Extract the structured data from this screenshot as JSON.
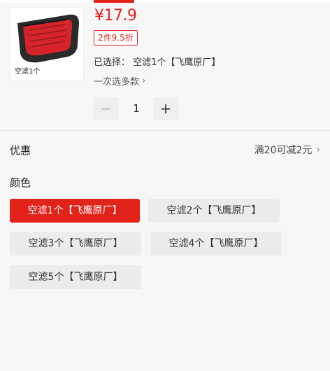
{
  "product": {
    "price": "¥17.9",
    "promo_tag": "2件9.5折",
    "selected_text": "已选择：  空滤1个【飞鹰原厂】",
    "multi_select_label": "一次选多款",
    "thumbnail_caption": "空滤1个",
    "quantity": "1",
    "accent_color": "#e2231a"
  },
  "stepper": {
    "minus": "−",
    "plus": "+"
  },
  "discount": {
    "label": "优惠",
    "value": "满20可减2元"
  },
  "color_section": {
    "label": "颜色",
    "selected_index": 0,
    "options": [
      "空滤1个【飞鹰原厂】",
      "空滤2个【飞鹰原厂】",
      "空滤3个【飞鹰原厂】",
      "空滤4个【飞鹰原厂】",
      "空滤5个【飞鹰原厂】"
    ]
  },
  "icons": {
    "chevron": "chevron-right-icon"
  }
}
